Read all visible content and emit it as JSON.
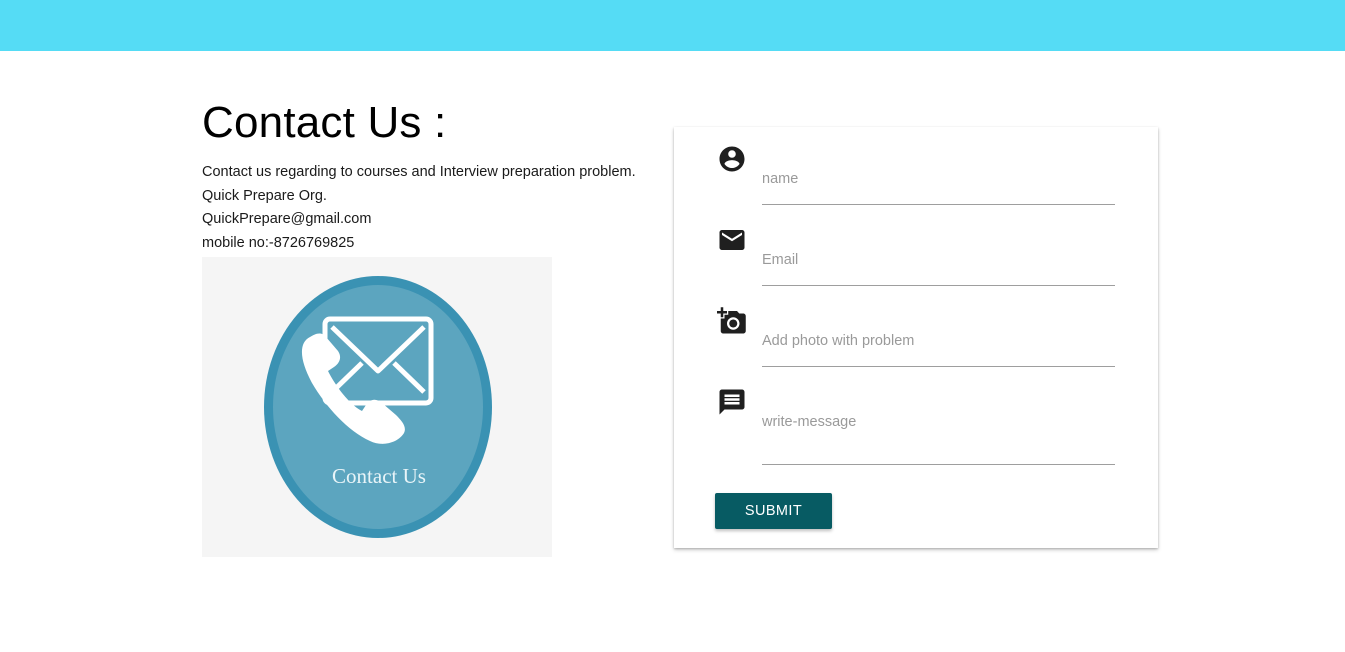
{
  "header": {
    "bar_color": "#55dcf5"
  },
  "contact": {
    "title": "Contact Us :",
    "lines": [
      "Contact us regarding to courses and Interview preparation problem.",
      "Quick Prepare Org.",
      "QuickPrepare@gmail.com",
      "mobile no:-8726769825"
    ],
    "image_caption": "Contact Us",
    "image_icons": [
      "phone-icon",
      "envelope-icon"
    ]
  },
  "form": {
    "fields": [
      {
        "icon": "account-circle-icon",
        "placeholder": "name",
        "value": ""
      },
      {
        "icon": "email-icon",
        "placeholder": "Email",
        "value": ""
      },
      {
        "icon": "add-a-photo-icon",
        "placeholder": "Add photo with problem",
        "value": ""
      },
      {
        "icon": "message-icon",
        "placeholder": "write-message",
        "value": ""
      }
    ],
    "submit_label": "SUBMIT"
  },
  "colors": {
    "accent": "#075b63",
    "badge_fill": "#5ca5bf",
    "badge_ring": "#3a92b3"
  }
}
